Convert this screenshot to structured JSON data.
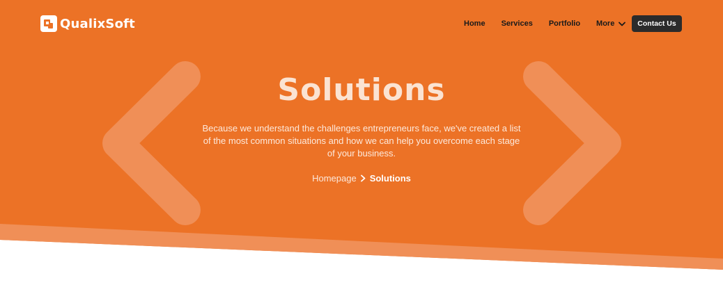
{
  "colors": {
    "brand_orange": "#EC7226",
    "chevron_overlay": "#F08F57",
    "button_dark": "#2B2B2B",
    "text_dark": "#1A1A1A"
  },
  "header": {
    "logo_text": "QualixSoft",
    "logo_icon": "qualixsoft-logo-icon"
  },
  "nav": {
    "items": [
      {
        "label": "Home"
      },
      {
        "label": "Services"
      },
      {
        "label": "Portfolio"
      },
      {
        "label": "More",
        "icon": "chevron-down-icon"
      }
    ],
    "contact_label": "Contact Us"
  },
  "hero": {
    "title": "Solutions",
    "description": "Because we understand the challenges entrepreneurs face, we've created a list of the most common situations and how we can help you overcome each stage of your business.",
    "breadcrumb": {
      "home": "Homepage",
      "separator_icon": "chevron-right-icon",
      "current": "Solutions"
    },
    "decor_left_icon": "chevron-left-icon",
    "decor_right_icon": "chevron-right-icon"
  }
}
